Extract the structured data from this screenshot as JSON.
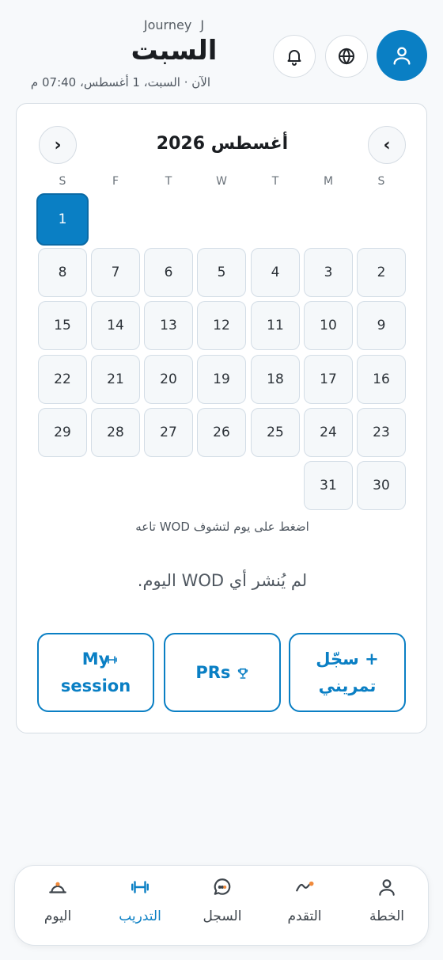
{
  "header": {
    "app_name": "Journey",
    "app_mark": "J",
    "day_title": "السبت",
    "now_line": "الآن · السبت، 1 أغسطس، 07:40 م",
    "icons": [
      "bell-icon",
      "globe-icon",
      "user-icon"
    ]
  },
  "calendar": {
    "month_title": "أغسطس 2026",
    "prev_arrow": "›",
    "next_arrow": "‹",
    "weekdays": [
      "S",
      "M",
      "T",
      "W",
      "T",
      "F",
      "S"
    ],
    "selected_day": "1",
    "days": [
      "1",
      "2",
      "3",
      "4",
      "5",
      "6",
      "7",
      "8",
      "9",
      "10",
      "11",
      "12",
      "13",
      "14",
      "15",
      "16",
      "17",
      "18",
      "19",
      "20",
      "21",
      "22",
      "23",
      "24",
      "25",
      "26",
      "27",
      "28",
      "29",
      "30",
      "31"
    ],
    "hint": "اضغط على يوم لتشوف WOD تاعه",
    "empty_message": "لم يُنشر أي WOD اليوم."
  },
  "actions": {
    "log_workout": "+ سجّل تمريني",
    "prs": "PRs",
    "my_session": "My session"
  },
  "bottom_nav": {
    "items": [
      {
        "label": "الخطة",
        "icon": "user-icon"
      },
      {
        "label": "التقدم",
        "icon": "trend-icon"
      },
      {
        "label": "السجل",
        "icon": "chat-icon"
      },
      {
        "label": "التدريب",
        "icon": "dumbbell-icon"
      },
      {
        "label": "اليوم",
        "icon": "cloche-icon"
      }
    ],
    "active": "التدريب"
  },
  "colors": {
    "accent": "#0a7fc4",
    "background": "#f7f9fb",
    "cell_bg": "#f5f8fa",
    "border": "#d5dce3",
    "nav_orange": "#f08a3c"
  }
}
